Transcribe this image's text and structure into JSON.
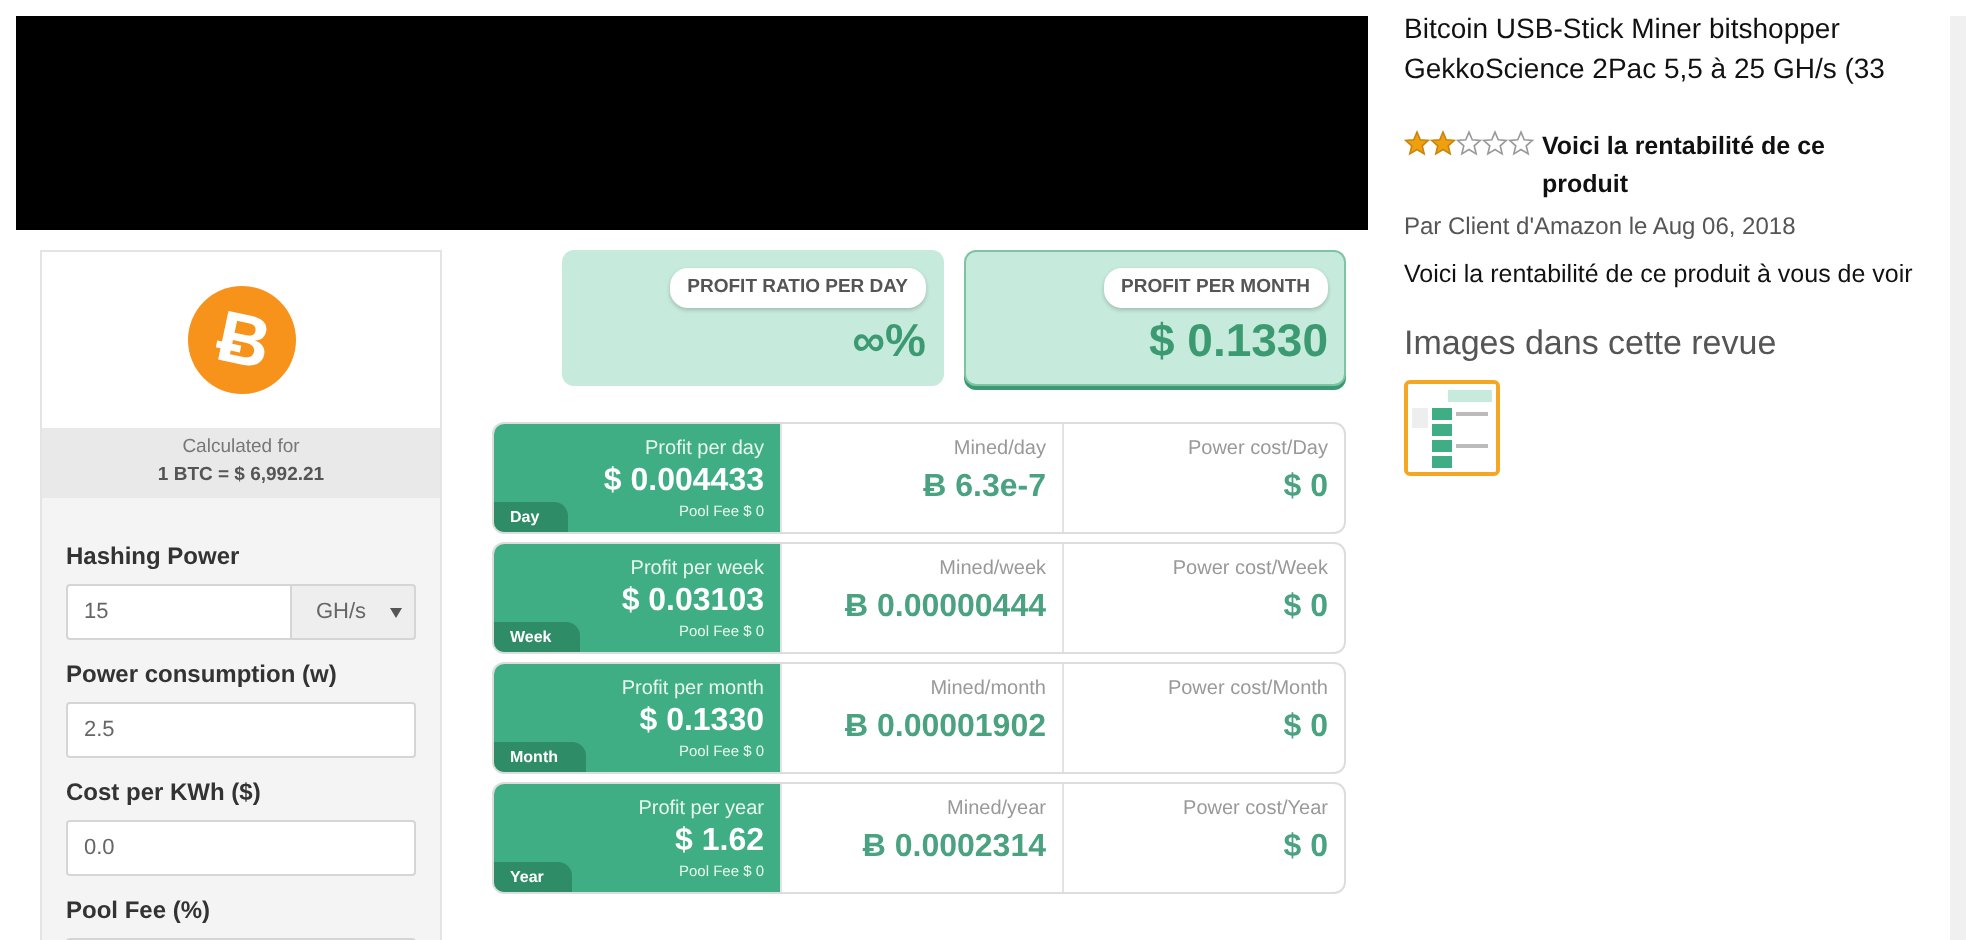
{
  "calculator": {
    "logo_symbol": "Ƀ",
    "caption": "Calculated for",
    "rate": "1 BTC = $ 6,992.21",
    "fields": [
      {
        "kind": "select",
        "label": "Hashing Power",
        "value": "15",
        "unit": "GH/s"
      },
      {
        "kind": "text",
        "label": "Power consumption (w)",
        "value": "2.5"
      },
      {
        "kind": "text",
        "label": "Cost per KWh ($)",
        "value": "0.0"
      },
      {
        "kind": "text",
        "label": "Pool Fee (%)"
      }
    ]
  },
  "summary": [
    {
      "label": "PROFIT RATIO PER DAY",
      "value": "∞%",
      "selected": false
    },
    {
      "label": "PROFIT PER MONTH",
      "value": "$ 0.1330",
      "selected": true
    }
  ],
  "periods": [
    {
      "tag": "Day",
      "profit_label": "Profit per day",
      "profit": "$ 0.004433",
      "pool_fee": "Pool Fee $ 0",
      "mined_label": "Mined/day",
      "mined": "Ƀ 6.3e-7",
      "power_label": "Power cost/Day",
      "power": "$ 0"
    },
    {
      "tag": "Week",
      "profit_label": "Profit per week",
      "profit": "$ 0.03103",
      "pool_fee": "Pool Fee $ 0",
      "mined_label": "Mined/week",
      "mined": "Ƀ 0.00000444",
      "power_label": "Power cost/Week",
      "power": "$ 0"
    },
    {
      "tag": "Month",
      "profit_label": "Profit per month",
      "profit": "$ 0.1330",
      "pool_fee": "Pool Fee $ 0",
      "mined_label": "Mined/month",
      "mined": "Ƀ 0.00001902",
      "power_label": "Power cost/Month",
      "power": "$ 0"
    },
    {
      "tag": "Year",
      "profit_label": "Profit per year",
      "profit": "$ 1.62",
      "pool_fee": "Pool Fee $ 0",
      "mined_label": "Mined/year",
      "mined": "Ƀ 0.0002314",
      "power_label": "Power cost/Year",
      "power": "$ 0"
    }
  ],
  "review": {
    "product_title": "Bitcoin USB-Stick Miner bitshopper GekkoScience 2Pac 5,5 à 25 GH/s (33",
    "stars": 2,
    "headline": "Voici la rentabilité de ce produit",
    "byline": "Par Client d'Amazon le Aug 06, 2018",
    "body": "Voici la rentabilité de ce produit à vous de voir",
    "images_heading": "Images dans cette revue"
  }
}
